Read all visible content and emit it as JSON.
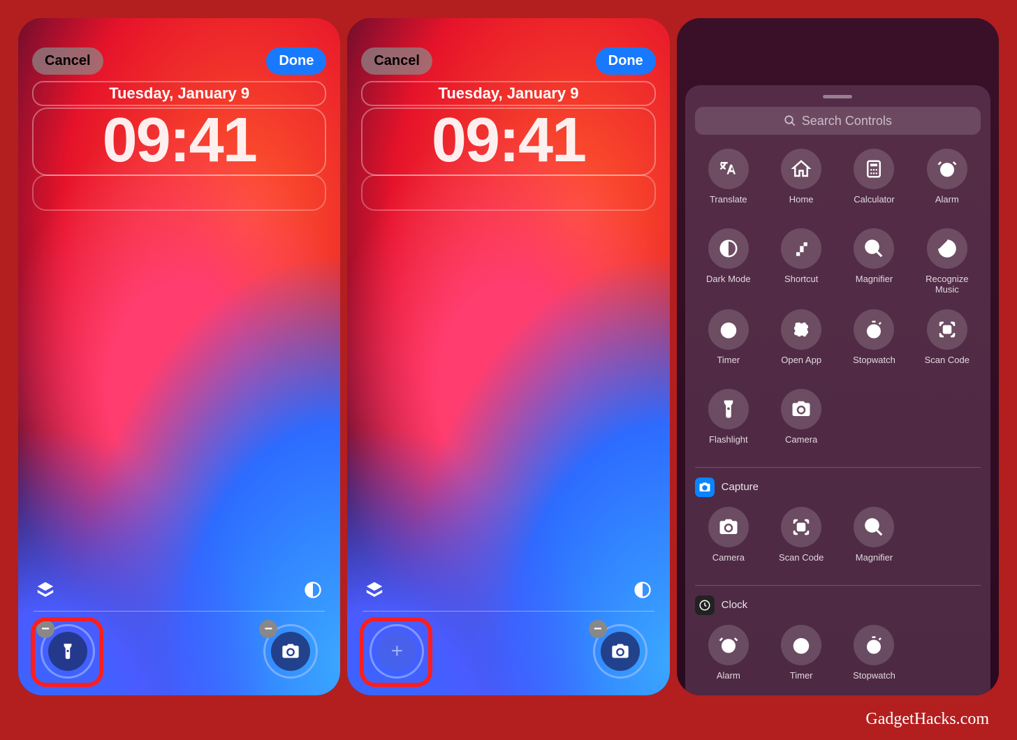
{
  "panels": [
    {
      "cancel": "Cancel",
      "done": "Done",
      "date": "Tuesday, January 9",
      "time": "09:41",
      "left_slot": "flashlight",
      "right_slot": "camera"
    },
    {
      "cancel": "Cancel",
      "done": "Done",
      "date": "Tuesday, January 9",
      "time": "09:41",
      "left_slot": "add",
      "right_slot": "camera"
    }
  ],
  "controls_picker": {
    "search_placeholder": "Search Controls",
    "items": [
      {
        "id": "translate",
        "label": "Translate"
      },
      {
        "id": "home",
        "label": "Home"
      },
      {
        "id": "calculator",
        "label": "Calculator"
      },
      {
        "id": "alarm",
        "label": "Alarm"
      },
      {
        "id": "darkmode",
        "label": "Dark Mode"
      },
      {
        "id": "shortcut",
        "label": "Shortcut"
      },
      {
        "id": "magnifier",
        "label": "Magnifier"
      },
      {
        "id": "recognize",
        "label": "Recognize Music"
      },
      {
        "id": "timer",
        "label": "Timer"
      },
      {
        "id": "openapp",
        "label": "Open App"
      },
      {
        "id": "stopwatch",
        "label": "Stopwatch"
      },
      {
        "id": "scancode",
        "label": "Scan Code"
      },
      {
        "id": "flashlight",
        "label": "Flashlight"
      },
      {
        "id": "camera",
        "label": "Camera"
      }
    ],
    "sections": [
      {
        "name": "Capture",
        "badge": "camera",
        "badge_color": "blue",
        "items": [
          {
            "id": "camera",
            "label": "Camera"
          },
          {
            "id": "scancode",
            "label": "Scan Code"
          },
          {
            "id": "magnifier",
            "label": "Magnifier"
          }
        ]
      },
      {
        "name": "Clock",
        "badge": "clock",
        "badge_color": "dark",
        "items": [
          {
            "id": "alarm",
            "label": "Alarm"
          },
          {
            "id": "timer",
            "label": "Timer"
          },
          {
            "id": "stopwatch",
            "label": "Stopwatch"
          }
        ]
      }
    ]
  },
  "watermark": "GadgetHacks.com"
}
